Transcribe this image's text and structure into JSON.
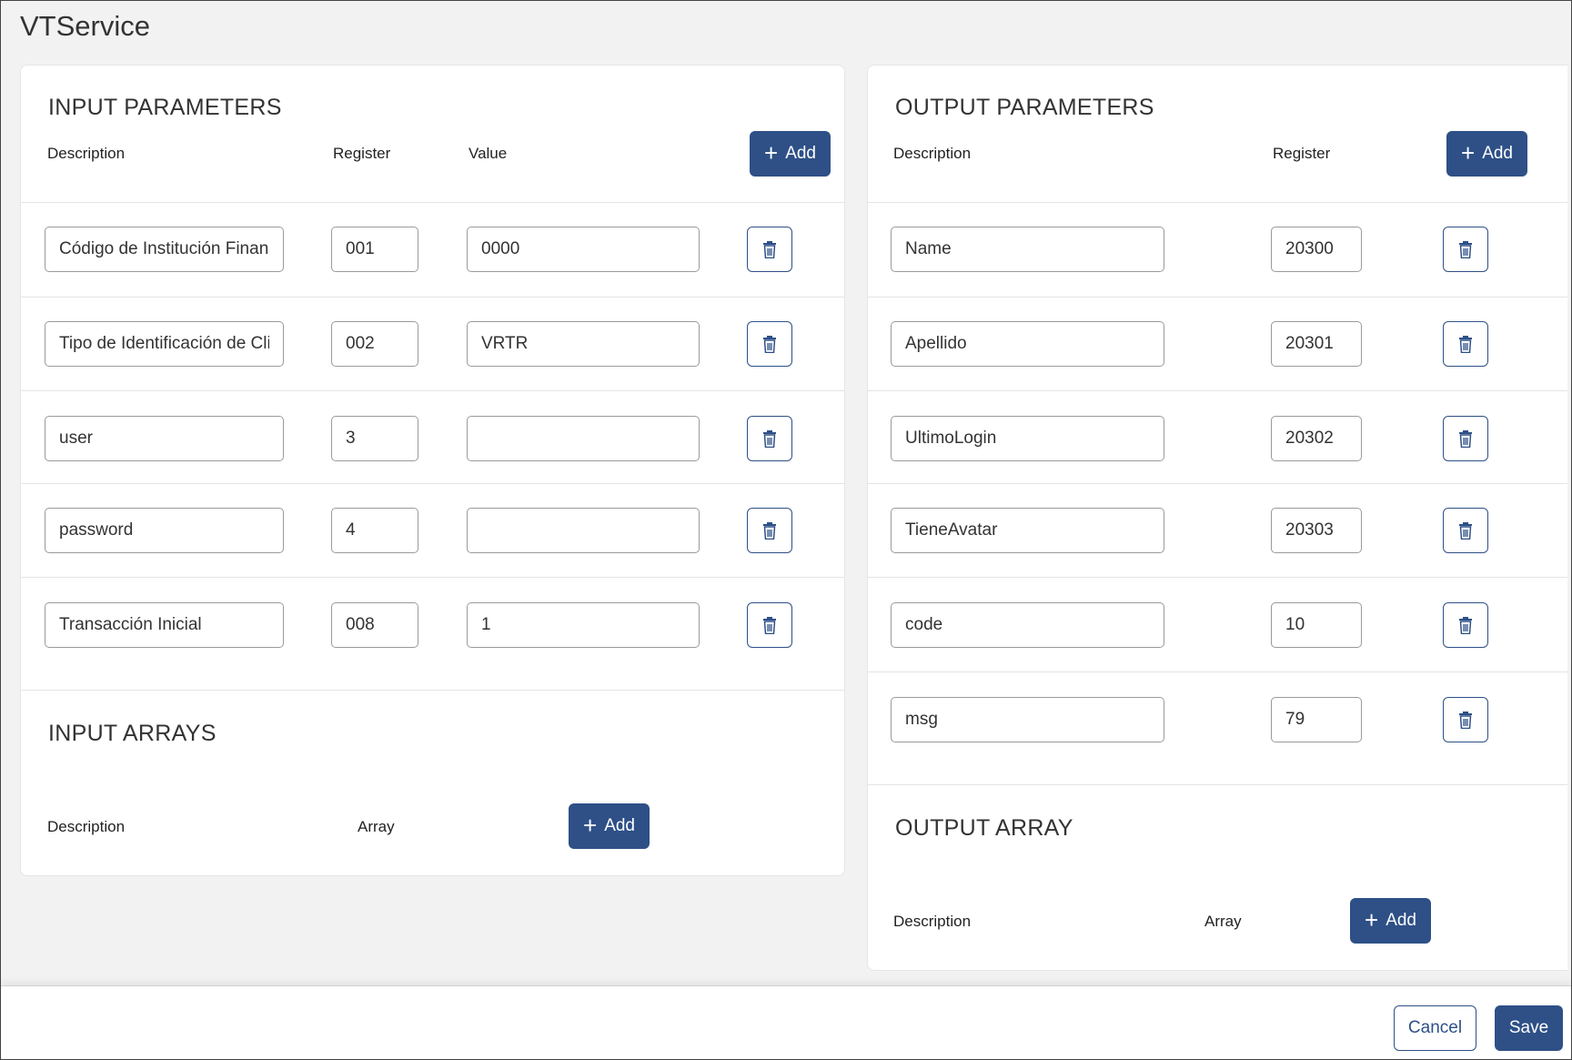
{
  "page_title": "VTService",
  "input_parameters": {
    "title": "INPUT PARAMETERS",
    "columns": {
      "description": "Description",
      "register": "Register",
      "value": "Value"
    },
    "add_label": "Add",
    "rows": [
      {
        "description": "Código de Institución Financiera",
        "register": "001",
        "value": "0000"
      },
      {
        "description": "Tipo de Identificación de Cliente",
        "register": "002",
        "value": "VRTR"
      },
      {
        "description": "user",
        "register": "3",
        "value": ""
      },
      {
        "description": "password",
        "register": "4",
        "value": ""
      },
      {
        "description": "Transacción Inicial",
        "register": "008",
        "value": "1"
      }
    ]
  },
  "input_arrays": {
    "title": "INPUT ARRAYS",
    "columns": {
      "description": "Description",
      "array": "Array"
    },
    "add_label": "Add"
  },
  "output_parameters": {
    "title": "OUTPUT PARAMETERS",
    "columns": {
      "description": "Description",
      "register": "Register"
    },
    "add_label": "Add",
    "rows": [
      {
        "description": "Name",
        "register": "20300"
      },
      {
        "description": "Apellido",
        "register": "20301"
      },
      {
        "description": "UltimoLogin",
        "register": "20302"
      },
      {
        "description": "TieneAvatar",
        "register": "20303"
      },
      {
        "description": "code",
        "register": "10"
      },
      {
        "description": "msg",
        "register": "79"
      }
    ]
  },
  "output_array": {
    "title": "OUTPUT ARRAY",
    "columns": {
      "description": "Description",
      "array": "Array"
    },
    "add_label": "Add"
  },
  "footer": {
    "cancel_label": "Cancel",
    "save_label": "Save"
  },
  "icons": {
    "add": "plus-icon",
    "delete": "trash-icon"
  },
  "colors": {
    "primary": "#2e5087",
    "background": "#f2f2f2",
    "card": "#ffffff"
  }
}
